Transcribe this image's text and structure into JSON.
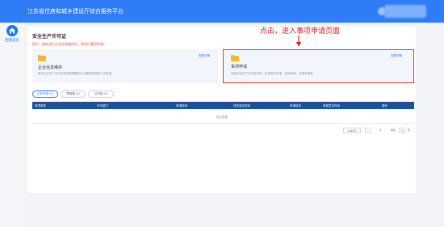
{
  "header": {
    "title": "江苏省住房和城乡建设厅综合服务平台"
  },
  "sidebar": {
    "home_label": "回到首页"
  },
  "page": {
    "title": "安全生产许可证",
    "hint": "提示：请先进行企业信息维护后，再进行事项申请。",
    "annotation": "点击，进入事项申请页面"
  },
  "panels": [
    {
      "title": "企业信息维护",
      "description": "维护企业生产许可证申请所需要的企业基础信息和人员信息。",
      "link": "查看详情"
    },
    {
      "title": "事项申请",
      "description": "发起安全生产许可证申请，包括首次申请、延续申请、变更申请等。",
      "link": "查看详情"
    }
  ],
  "tabs": [
    {
      "label": "正在申请 (0)",
      "active": true
    },
    {
      "label": "草稿箱 (0)",
      "active": false
    },
    {
      "label": "已归档 (0)",
      "active": false
    }
  ],
  "table": {
    "columns": [
      "事项类型",
      "许可部门",
      "申请时间",
      "任务到达时间",
      "申请状态",
      "审核意见时间",
      "操作"
    ],
    "empty_text": "暂无数据"
  },
  "pagination": {
    "page_size": "10条/页",
    "prev": "‹",
    "current_page": "1",
    "next": "›",
    "goto_label": "前往",
    "goto_value": "1",
    "goto_unit": "页"
  },
  "colors": {
    "brand": "#2f7cf6",
    "table_header": "#1e4f9a",
    "annotation": "#e01e1e"
  }
}
